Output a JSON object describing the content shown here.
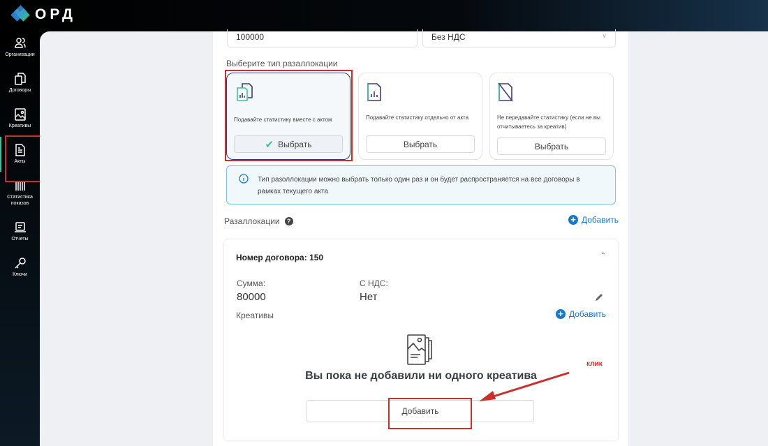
{
  "app": {
    "logo": "ОРД"
  },
  "sidebar": {
    "items": [
      {
        "label": "Организации",
        "icon": "users-icon"
      },
      {
        "label": "Договоры",
        "icon": "documents-icon"
      },
      {
        "label": "Креативы",
        "icon": "image-icon"
      },
      {
        "label": "Акты",
        "icon": "document-icon",
        "active": true
      },
      {
        "label": "Статистика показов",
        "icon": "stats-icon"
      },
      {
        "label": "Отчеты",
        "icon": "report-icon"
      },
      {
        "label": "Ключи",
        "icon": "key-icon"
      }
    ]
  },
  "form": {
    "amount_value": "100000",
    "vat_value": "Без НДС"
  },
  "allocation": {
    "title": "Выберите тип разаллокации",
    "options": [
      {
        "text": "Подавайте статистику вместе с актом",
        "button": "Выбрать",
        "selected": true
      },
      {
        "text": "Подавайте статистику отдельно от акта",
        "button": "Выбрать",
        "selected": false
      },
      {
        "text": "Не передавайте статистику (если не вы отчитываетесь за креатив)",
        "button": "Выбрать",
        "selected": false
      }
    ],
    "info": "Тип разоллокации можно выбрать только один раз и он будет распространяется на все договоры в рамках текущего акта"
  },
  "allocations": {
    "title": "Разаллокации",
    "add": "Добавить",
    "contract": {
      "title": "Номер договора: 150",
      "sum_label": "Сумма:",
      "sum_value": "80000",
      "vat_label": "С НДС:",
      "vat_value": "Нет",
      "creatives_label": "Креативы",
      "add": "Добавить",
      "empty": "Вы пока не добавили ни одного креатива",
      "add_button": "Добавить"
    }
  },
  "annotation": {
    "text": "клик",
    "color": "#c9302c"
  },
  "colors": {
    "accent": "#1877c9",
    "check": "#3cc29a"
  }
}
